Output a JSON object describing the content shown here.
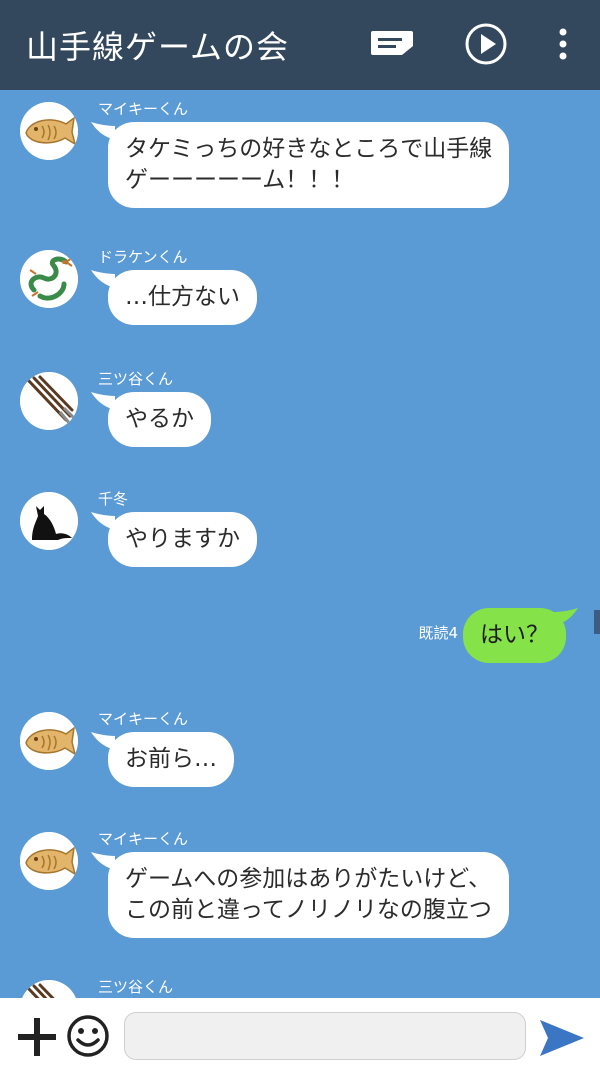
{
  "header": {
    "title": "山手線ゲームの会",
    "icons": [
      "note-icon",
      "play-icon",
      "more-vertical-icon"
    ]
  },
  "messages": [
    {
      "type": "received",
      "sender": "マイキーくん",
      "avatar": "taiyaki",
      "lines": [
        "タケミっちの好きなところで山手線",
        "ゲーーーーーム！！！"
      ]
    },
    {
      "type": "received",
      "sender": "ドラケンくん",
      "avatar": "dragon",
      "lines": [
        "…仕方ない"
      ]
    },
    {
      "type": "received",
      "sender": "三ツ谷くん",
      "avatar": "sticks",
      "lines": [
        "やるか"
      ]
    },
    {
      "type": "received",
      "sender": "千冬",
      "avatar": "cat",
      "lines": [
        "やりますか"
      ]
    },
    {
      "type": "sent",
      "read_label": "既読4",
      "lines": [
        "はい？"
      ]
    },
    {
      "type": "received",
      "sender": "マイキーくん",
      "avatar": "taiyaki",
      "lines": [
        "お前ら…"
      ]
    },
    {
      "type": "received",
      "sender": "マイキーくん",
      "avatar": "taiyaki",
      "lines": [
        "ゲームへの参加はありがたいけど、",
        "この前と違ってノリノリなの腹立つ"
      ]
    },
    {
      "type": "received",
      "sender": "三ツ谷くん",
      "avatar": "sticks",
      "lines": []
    }
  ],
  "input_bar": {
    "message_value": "",
    "icons": [
      "plus-icon",
      "emoji-icon",
      "send-icon"
    ]
  },
  "colors": {
    "header_bg": "#33485d",
    "chat_bg": "#5b9bd5",
    "received_bubble": "#ffffff",
    "sent_bubble": "#85e249",
    "send_icon": "#3a76c4"
  }
}
